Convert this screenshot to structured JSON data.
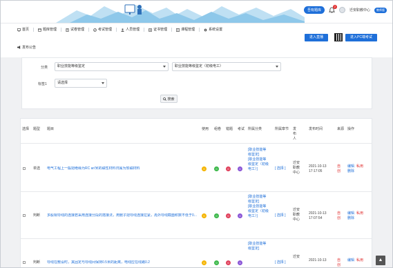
{
  "header": {
    "register_pill": "吾有题库",
    "notifications": "2",
    "user_name": "迁安职教中心",
    "user_tag": "教师版"
  },
  "nav": {
    "items": [
      {
        "label": "首页",
        "icon": "monitor-icon"
      },
      {
        "label": "题库管理",
        "icon": "database-icon"
      },
      {
        "label": "试卷管理",
        "icon": "paper-icon"
      },
      {
        "label": "考试管理",
        "icon": "exam-icon"
      },
      {
        "label": "人员管理",
        "icon": "people-icon"
      },
      {
        "label": "证书管理",
        "icon": "certificate-icon"
      },
      {
        "label": "课程管理",
        "icon": "course-icon"
      },
      {
        "label": "系统设置",
        "icon": "gear-icon"
      }
    ],
    "announcement": "发布公告",
    "live_button": "进入直播",
    "exam_button": "进入PC端考试"
  },
  "filter": {
    "category_label": "分类",
    "category_value": "职业技能等级鉴定",
    "subcategory_value": "职业技能等级鉴定（初级电工）",
    "tag_label": "标签1",
    "tag_value": "请选择",
    "search_button": "搜索"
  },
  "table": {
    "headers": {
      "select": "选择",
      "type": "题型",
      "stem": "题目",
      "used": "使用",
      "group": "组卷",
      "error": "错题",
      "exam": "考试",
      "category": "所属分类",
      "chapter": "所属章节",
      "publisher": "发布人",
      "time": "发布时间",
      "source": "来源",
      "ops": "操作"
    },
    "rows": [
      {
        "type": "单选",
        "stem": "电气工程上一般把绝缘为RC ar/米的磁性材料归属为软磁材料",
        "counts": [
          "0",
          "0",
          "0",
          "0"
        ],
        "category": "[职业技能等级鉴定]\n[职业技能等级鉴定（初级电工）]",
        "chapter": "[ 选择 ]",
        "publisher": "迁安职教中心",
        "time": "2021-10-13 17:17:05",
        "source": "自创",
        "ops": [
          "编辑",
          "私用",
          "删除"
        ]
      },
      {
        "type": "判断",
        "stem": "多股铜导线的连接若采用连接分段的搭接法，用鲍子把导线连接拉紧，再外导线截面积数不低于0...",
        "counts": [
          "0",
          "0",
          "0",
          "0"
        ],
        "category": "[职业技能等级鉴定]\n[职业技能等级鉴定（初级电工）]",
        "chapter": "[ 选择 ]",
        "publisher": "迁安职教中心",
        "time": "2021-10-13 17:07:54",
        "source": "自创",
        "ops": [
          "编辑",
          "私用",
          "删除"
        ]
      },
      {
        "type": "判断",
        "stem": "导线在敷设时，其固定与导线间保持0.5米的距离，电线应在线路0.2",
        "counts": [
          "0",
          "0",
          "0",
          "0"
        ],
        "category": "[职业技能等级鉴定]",
        "chapter": "[ 选择 ]",
        "publisher": "迁安",
        "time": "2021-10-13",
        "source": "自创",
        "ops": [
          "编辑",
          "私用"
        ]
      }
    ]
  },
  "colors": {
    "accent": "#1e6fd9",
    "used": "#f5b400",
    "group": "#3cb84a",
    "error": "#e0405b",
    "exam": "#8a55d6"
  }
}
